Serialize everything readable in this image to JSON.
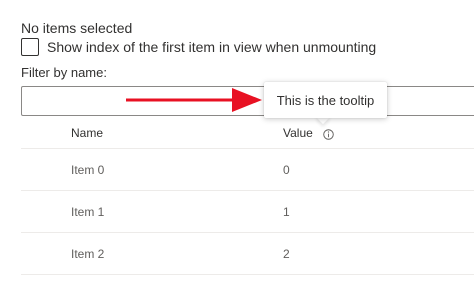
{
  "selection": {
    "status": "No items selected"
  },
  "options": {
    "show_index_label": "Show index of the first item in view when unmounting",
    "show_index_checked": false
  },
  "filter": {
    "label": "Filter by name:",
    "value": "",
    "placeholder": ""
  },
  "tooltip": {
    "text": "This is the tooltip"
  },
  "annotation": {
    "arrow_color": "#e81123"
  },
  "table": {
    "columns": [
      "Name",
      "Value"
    ],
    "value_header_icon": "info-icon",
    "rows": [
      {
        "name": "Item 0",
        "value": "0"
      },
      {
        "name": "Item 1",
        "value": "1"
      },
      {
        "name": "Item 2",
        "value": "2"
      }
    ]
  }
}
